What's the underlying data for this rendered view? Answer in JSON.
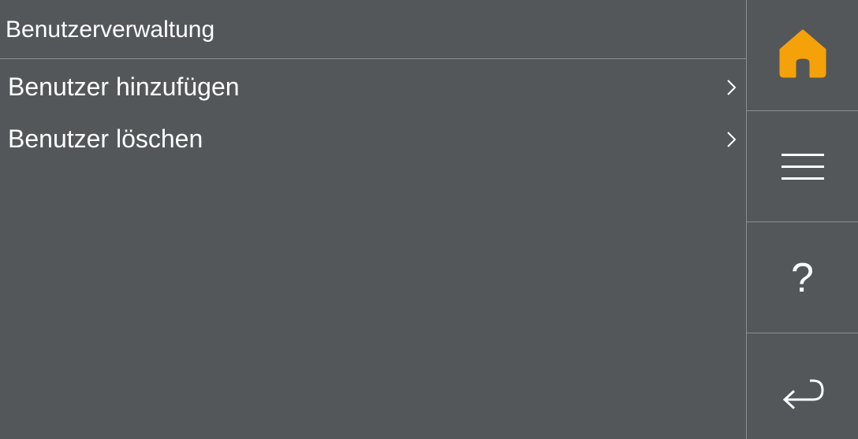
{
  "header": {
    "title": "Benutzerverwaltung"
  },
  "menu": {
    "items": [
      {
        "label": "Benutzer hinzufügen",
        "icon": "chevron-right-icon"
      },
      {
        "label": "Benutzer löschen",
        "icon": "chevron-right-icon"
      }
    ]
  },
  "sidebar": {
    "buttons": [
      {
        "icon": "home-icon",
        "color": "#f5a10a"
      },
      {
        "icon": "menu-icon",
        "color": "#ffffff"
      },
      {
        "icon": "help-icon",
        "glyph": "?",
        "color": "#ffffff"
      },
      {
        "icon": "back-icon",
        "color": "#ffffff"
      }
    ]
  },
  "colors": {
    "background": "#53575a",
    "divider": "#8a8e91",
    "text": "#ffffff",
    "accent": "#f5a10a"
  }
}
